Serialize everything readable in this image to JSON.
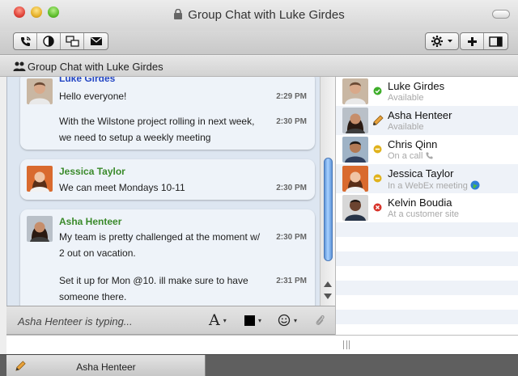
{
  "window": {
    "title": "Group Chat with Luke Girdes"
  },
  "conversation": {
    "header_title": "Group Chat with Luke Girdes",
    "messages": [
      {
        "sender": "Luke Girdes",
        "sender_color": "#2547c4",
        "lines": [
          {
            "text": "Hello everyone!",
            "time": "2:29 PM"
          },
          {
            "text": "With the Wilstone project rolling in next week,",
            "time": "2:30 PM"
          },
          {
            "text": "we need to setup a weekly meeting",
            "time": ""
          }
        ]
      },
      {
        "sender": "Jessica Taylor",
        "sender_color": "#3a8a2a",
        "lines": [
          {
            "text": "We can meet Mondays 10-11",
            "time": "2:30 PM"
          }
        ]
      },
      {
        "sender": "Asha Henteer",
        "sender_color": "#3a8a2a",
        "lines": [
          {
            "text": "My team is pretty challenged at the moment w/",
            "time": "2:30 PM"
          },
          {
            "text": "2 out on vacation.",
            "time": ""
          },
          {
            "text": "Set it up for Mon @10. ill make sure to have",
            "time": "2:31 PM"
          },
          {
            "text": "someone there.",
            "time": ""
          }
        ]
      }
    ],
    "typing_status": "Asha Henteer is typing...",
    "compose_value": ""
  },
  "toolbar": {
    "left_icons": [
      "phone-icon",
      "contrast-icon",
      "screen-share-icon",
      "mail-icon"
    ],
    "right_icons": [
      "gear-icon",
      "add-icon",
      "sidebar-toggle-icon"
    ]
  },
  "format_bar": {
    "font_label": "A"
  },
  "roster": {
    "contacts": [
      {
        "name": "Luke Girdes",
        "status": "Available",
        "status_color": "#3fae2a"
      },
      {
        "name": "Asha Henteer",
        "status": "Available",
        "status_color": "#3fae2a"
      },
      {
        "name": "Chris Qinn",
        "status": "On a call",
        "status_color": "#e0b21c"
      },
      {
        "name": "Jessica Taylor",
        "status": "In a WebEx meeting",
        "status_color": "#e0b21c"
      },
      {
        "name": "Kelvin Boudia",
        "status": "At a customer site",
        "status_color": "#d8342a"
      }
    ]
  },
  "tabs": [
    {
      "label": "Asha Henteer",
      "active": true
    }
  ]
}
